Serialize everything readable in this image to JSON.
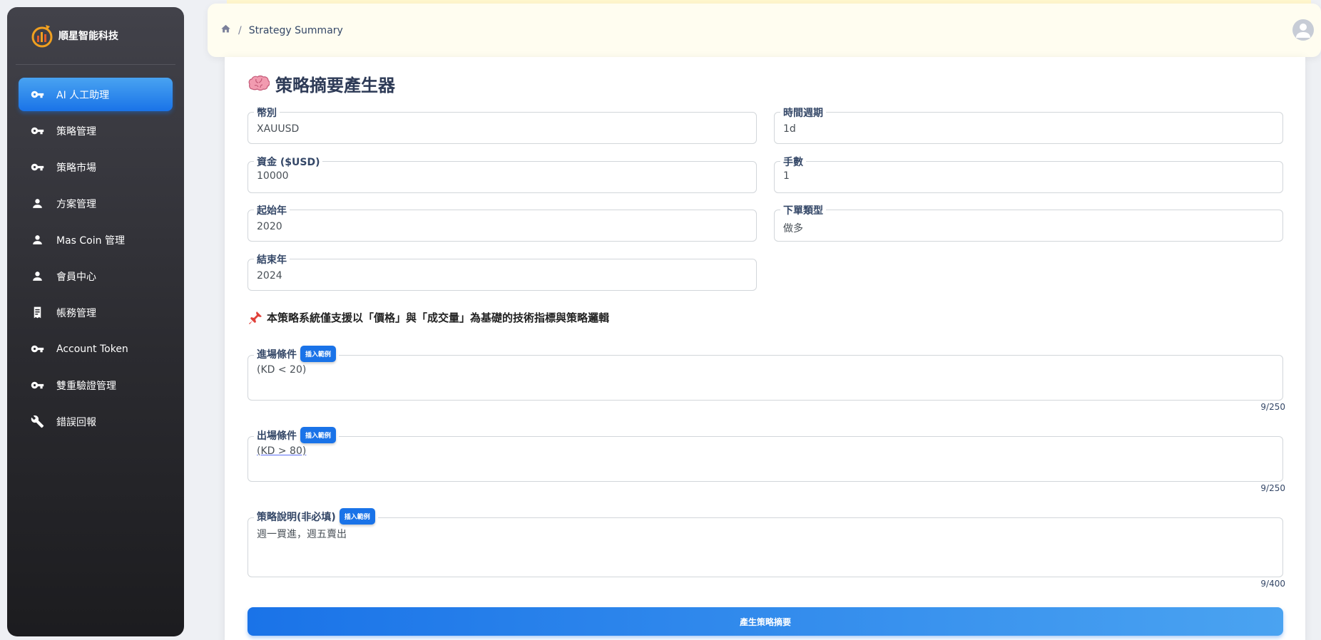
{
  "brand": {
    "name": "順星智能科技"
  },
  "sidebar": {
    "items": [
      {
        "label": "AI 人工助理",
        "icon": "key-icon",
        "active": true
      },
      {
        "label": "策略管理",
        "icon": "key-icon"
      },
      {
        "label": "策略市場",
        "icon": "key-icon"
      },
      {
        "label": "方案管理",
        "icon": "person-icon"
      },
      {
        "label": "Mas Coin 管理",
        "icon": "person-icon"
      },
      {
        "label": "會員中心",
        "icon": "person-icon"
      },
      {
        "label": "帳務管理",
        "icon": "receipt-icon"
      },
      {
        "label": "Account Token",
        "icon": "key-icon"
      },
      {
        "label": "雙重驗證管理",
        "icon": "key-icon"
      },
      {
        "label": "錯誤回報",
        "icon": "wrench-icon"
      }
    ]
  },
  "breadcrumb": {
    "current": "Strategy Summary"
  },
  "card": {
    "title": "策略摘要產生器"
  },
  "form": {
    "currency": {
      "label": "幣別",
      "value": "XAUUSD"
    },
    "timeframe": {
      "label": "時間週期",
      "value": "1d"
    },
    "capital": {
      "label": "資金 ($USD)",
      "value": "10000"
    },
    "lots": {
      "label": "手數",
      "value": "1"
    },
    "start_year": {
      "label": "起始年",
      "value": "2020"
    },
    "order_type": {
      "label": "下單類型",
      "value": "做多"
    },
    "end_year": {
      "label": "結束年",
      "value": "2024"
    }
  },
  "notice": "本策略系統僅支援以「價格」與「成交量」為基礎的技術指標與策略邏輯",
  "entry": {
    "label": "進場條件",
    "insert_label": "插入範例",
    "value": "(KD < 20)",
    "counter": "9/250"
  },
  "exit": {
    "label": "出場條件",
    "insert_label": "插入範例",
    "value": "(KD > 80)",
    "counter": "9/250"
  },
  "description": {
    "label": "策略說明(非必填)",
    "insert_label": "插入範例",
    "value": "週一買進，週五賣出",
    "counter": "9/400"
  },
  "submit_label": "產生策略摘要",
  "colors": {
    "accent": "#1a73e8",
    "sidebar_dark": "#1c1c1f"
  }
}
